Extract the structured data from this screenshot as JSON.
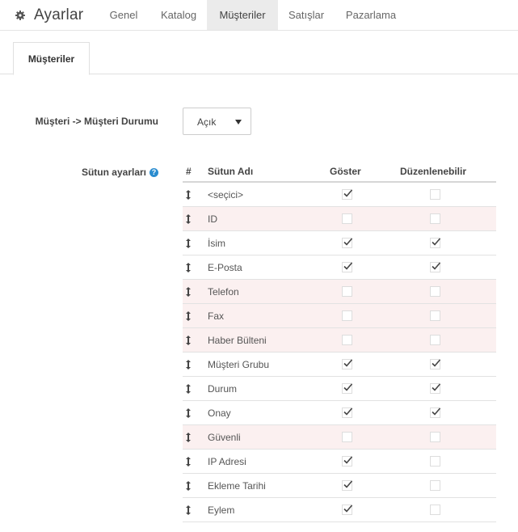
{
  "app": {
    "title": "Ayarlar",
    "icon": "gear-icon"
  },
  "nav": {
    "tabs": [
      {
        "label": "Genel",
        "active": false
      },
      {
        "label": "Katalog",
        "active": false
      },
      {
        "label": "Müşteriler",
        "active": true
      },
      {
        "label": "Satışlar",
        "active": false
      },
      {
        "label": "Pazarlama",
        "active": false
      }
    ]
  },
  "subtab": {
    "label": "Müşteriler"
  },
  "status_field": {
    "label": "Müşteri -> Müşteri Durumu",
    "value": "Açık"
  },
  "columns_field": {
    "label": "Sütun ayarları",
    "help": "?"
  },
  "table": {
    "headers": {
      "index": "#",
      "name": "Sütun Adı",
      "show": "Göster",
      "editable": "Düzenlenebilir"
    },
    "rows": [
      {
        "name": "<seçici>",
        "show": true,
        "editable": false
      },
      {
        "name": "ID",
        "show": false,
        "editable": false
      },
      {
        "name": "İsim",
        "show": true,
        "editable": true
      },
      {
        "name": "E-Posta",
        "show": true,
        "editable": true
      },
      {
        "name": "Telefon",
        "show": false,
        "editable": false
      },
      {
        "name": "Fax",
        "show": false,
        "editable": false
      },
      {
        "name": "Haber Bülteni",
        "show": false,
        "editable": false
      },
      {
        "name": "Müşteri Grubu",
        "show": true,
        "editable": true
      },
      {
        "name": "Durum",
        "show": true,
        "editable": true
      },
      {
        "name": "Onay",
        "show": true,
        "editable": true
      },
      {
        "name": "Güvenli",
        "show": false,
        "editable": false
      },
      {
        "name": "IP Adresi",
        "show": true,
        "editable": false
      },
      {
        "name": "Ekleme Tarihi",
        "show": true,
        "editable": false
      },
      {
        "name": "Eylem",
        "show": true,
        "editable": false
      }
    ]
  },
  "colors": {
    "disabled_row": "#fbf0f0",
    "help_icon": "#2a8ccf",
    "active_tab": "#ebebeb"
  }
}
